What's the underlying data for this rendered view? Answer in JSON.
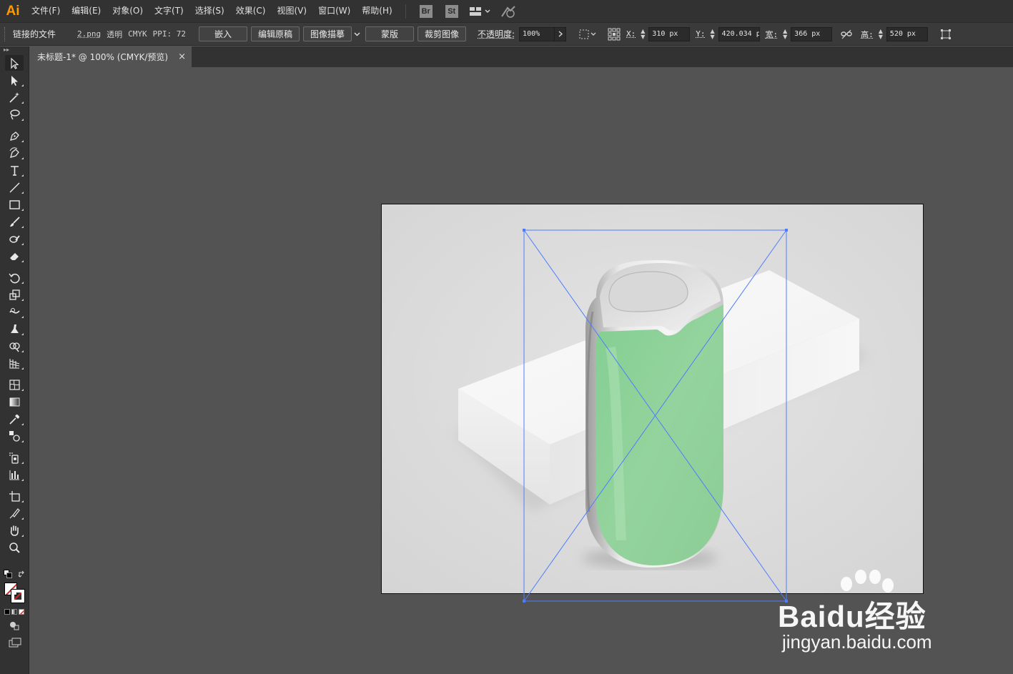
{
  "app": {
    "logo": "Ai"
  },
  "menu": [
    "文件(F)",
    "编辑(E)",
    "对象(O)",
    "文字(T)",
    "选择(S)",
    "效果(C)",
    "视图(V)",
    "窗口(W)",
    "帮助(H)"
  ],
  "app_badges": [
    "Br",
    "St"
  ],
  "control_bar": {
    "linked_file_label": "链接的文件",
    "filename": "2.png",
    "info_transparent": "透明",
    "info_mode": "CMYK",
    "info_ppi": "PPI: 72",
    "buttons": [
      "嵌入",
      "编辑原稿",
      "图像描摹",
      "蒙版",
      "裁剪图像"
    ],
    "opacity_label": "不透明度:",
    "opacity_value": "100%",
    "x_label": "X:",
    "x_value": "310 px",
    "y_label": "Y:",
    "y_value": "420.034 p",
    "w_label": "宽:",
    "w_value": "366 px",
    "h_label": "高:",
    "h_value": "520 px"
  },
  "document_tab": {
    "title": "未标题-1* @ 100% (CMYK/预览)",
    "close": "×"
  },
  "watermark": {
    "brand": "Baidu经验",
    "url": "jingyan.baidu.com"
  },
  "colors": {
    "menubar_bg": "#323232",
    "canvas_bg": "#535353",
    "artboard_bg": "#d9d9d9",
    "selection_blue": "#4f7cff",
    "device_green": "#8fd39b",
    "ai_orange": "#ff9a00"
  }
}
